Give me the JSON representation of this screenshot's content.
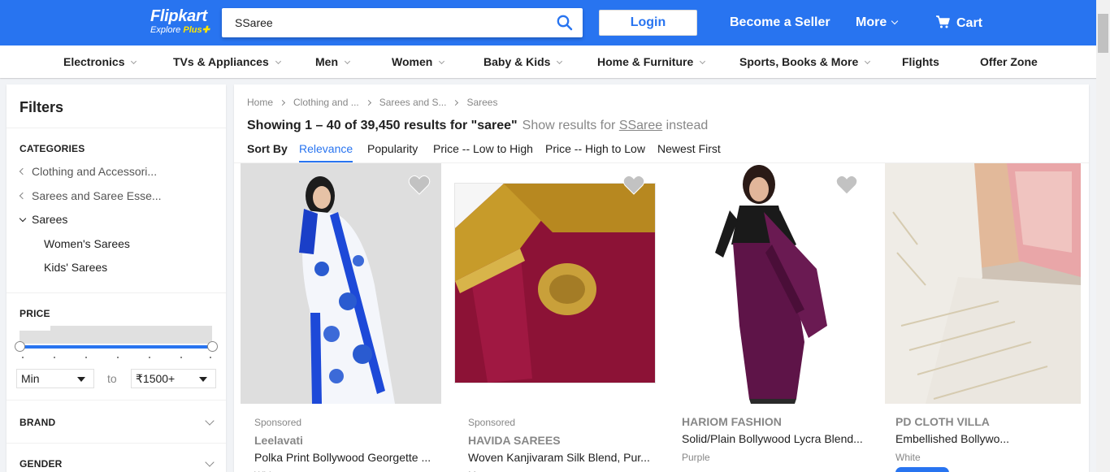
{
  "header": {
    "logo_text": "Flipkart",
    "logo_sub": "Explore",
    "logo_plus": "Plus",
    "search_value": "SSaree",
    "login_label": "Login",
    "become_seller": "Become a Seller",
    "more": "More",
    "cart": "Cart",
    "brand_color": "#2874f0"
  },
  "categories": [
    {
      "label": "Electronics",
      "has_dropdown": true
    },
    {
      "label": "TVs & Appliances",
      "has_dropdown": true
    },
    {
      "label": "Men",
      "has_dropdown": true
    },
    {
      "label": "Women",
      "has_dropdown": true
    },
    {
      "label": "Baby & Kids",
      "has_dropdown": true
    },
    {
      "label": "Home & Furniture",
      "has_dropdown": true
    },
    {
      "label": "Sports, Books & More",
      "has_dropdown": true
    },
    {
      "label": "Flights",
      "has_dropdown": false
    },
    {
      "label": "Offer Zone",
      "has_dropdown": false
    }
  ],
  "filters": {
    "title": "Filters",
    "categories_heading": "CATEGORIES",
    "category_path": [
      {
        "label": "Clothing and Accessori...",
        "type": "parent"
      },
      {
        "label": "Sarees and Saree Esse...",
        "type": "parent"
      },
      {
        "label": "Sarees",
        "type": "current"
      },
      {
        "label": "Women's Sarees",
        "type": "child"
      },
      {
        "label": "Kids' Sarees",
        "type": "child"
      }
    ],
    "price_heading": "PRICE",
    "price_min": "Min",
    "price_to": "to",
    "price_max": "₹1500+",
    "brand_heading": "BRAND",
    "gender_heading": "GENDER"
  },
  "main": {
    "breadcrumb": [
      "Home",
      "Clothing and ...",
      "Sarees and S...",
      "Sarees"
    ],
    "results_text": "Showing 1 – 40 of 39,450 results for \"saree\"",
    "alt_prefix": "Show results for",
    "alt_query": "SSaree",
    "alt_suffix": "instead",
    "sort_label": "Sort By",
    "sort_options": [
      "Relevance",
      "Popularity",
      "Price -- Low to High",
      "Price -- High to Low",
      "Newest First"
    ],
    "sort_active": "Relevance"
  },
  "products": [
    {
      "sponsored": "Sponsored",
      "brand": "Leelavati",
      "title": "Polka Print Bollywood Georgette ...",
      "color": "White"
    },
    {
      "sponsored": "Sponsored",
      "brand": "HAVIDA SAREES",
      "title": "Woven Kanjivaram Silk Blend, Pur...",
      "color": "Maroon"
    },
    {
      "sponsored": "",
      "brand": "HARIOM FASHION",
      "title": "Solid/Plain Bollywood Lycra Blend...",
      "color": "Purple"
    },
    {
      "sponsored": "",
      "brand": "PD CLOTH VILLA",
      "title": "Embellished Bollywo...",
      "color": "White"
    }
  ]
}
